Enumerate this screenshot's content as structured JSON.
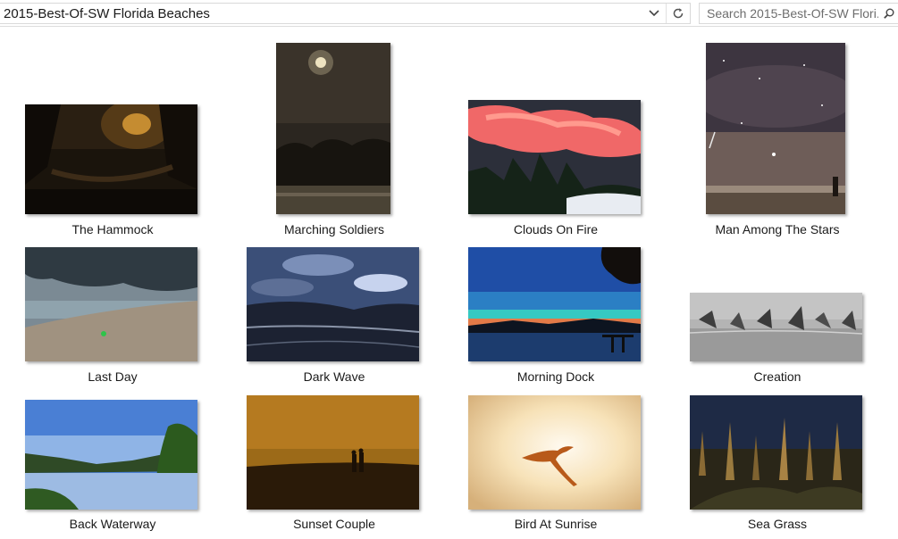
{
  "address_bar": {
    "path": "2015-Best-Of-SW Florida Beaches"
  },
  "search": {
    "placeholder": "Search 2015-Best-Of-SW Flori..."
  },
  "icons": {
    "dropdown": "chevron-down-icon",
    "refresh": "refresh-icon",
    "search": "search-icon"
  },
  "items": [
    {
      "caption": "The Hammock"
    },
    {
      "caption": "Marching Soldiers"
    },
    {
      "caption": "Clouds On Fire"
    },
    {
      "caption": "Man Among The Stars"
    },
    {
      "caption": "Last Day"
    },
    {
      "caption": "Dark Wave"
    },
    {
      "caption": "Morning Dock"
    },
    {
      "caption": "Creation"
    },
    {
      "caption": "Back Waterway"
    },
    {
      "caption": "Sunset Couple"
    },
    {
      "caption": "Bird At Sunrise"
    },
    {
      "caption": "Sea Grass"
    }
  ]
}
